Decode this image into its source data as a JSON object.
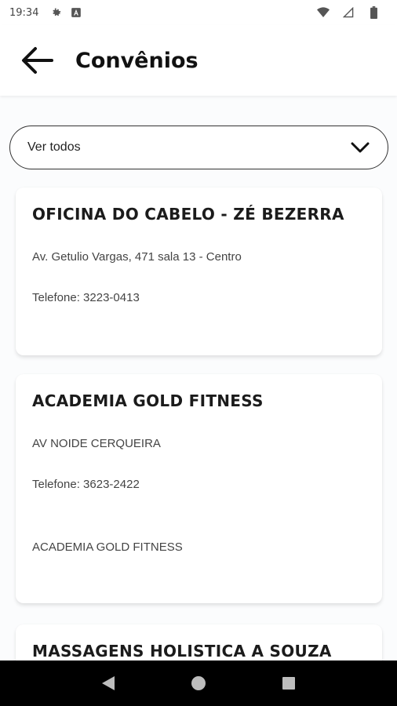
{
  "status_bar": {
    "time": "19:34",
    "icons_left": [
      "settings-icon",
      "font-download-icon"
    ],
    "icons_right": [
      "wifi-icon",
      "signal-icon",
      "battery-icon"
    ]
  },
  "app_bar": {
    "title": "Convênios",
    "back_icon": "arrow-left-icon"
  },
  "filter": {
    "selected": "Ver todos",
    "icon": "chevron-down-icon"
  },
  "cards": [
    {
      "title": "OFICINA DO CABELO - ZÉ BEZERRA",
      "address": "Av. Getulio Vargas, 471 sala 13 - Centro",
      "phone": "Telefone: 3223-0413",
      "extra": ""
    },
    {
      "title": "ACADEMIA GOLD FITNESS",
      "address": "AV NOIDE CERQUEIRA",
      "phone": "Telefone: 3623-2422",
      "extra": "ACADEMIA GOLD FITNESS"
    },
    {
      "title": "MASSAGENS HOLISTICA A SOUZA",
      "address": "",
      "phone": "",
      "extra": ""
    }
  ],
  "nav_bar": {
    "icons": [
      "back-triangle-icon",
      "home-circle-icon",
      "recents-square-icon"
    ]
  },
  "colors": {
    "background": "#fbfcfd",
    "navbar": "#000000",
    "text": "#1a1a1a"
  }
}
